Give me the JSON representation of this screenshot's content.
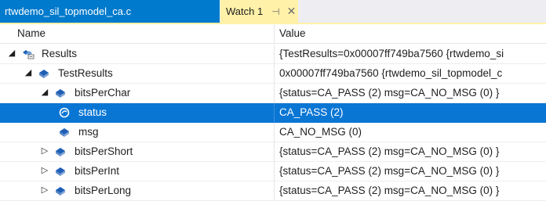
{
  "tabs": [
    {
      "label": "rtwdemo_sil_topmodel_ca.c",
      "active": false
    },
    {
      "label": "Watch 1",
      "active": true
    }
  ],
  "tab_icons": {
    "pin": "pin-icon",
    "close": "close-icon"
  },
  "columns": {
    "name": "Name",
    "value": "Value"
  },
  "colors": {
    "selection": "#0a76d4",
    "tab_active": "#fff1a8",
    "tab_inactive": "#007acc"
  },
  "rows": [
    {
      "name": "Results",
      "value": "{TestResults=0x00007ff749ba7560 {rtwdemo_si",
      "depth": 0,
      "expander": "expanded",
      "icon": "struct-icon"
    },
    {
      "name": "TestResults",
      "value": "0x00007ff749ba7560 {rtwdemo_sil_topmodel_c",
      "depth": 1,
      "expander": "expanded",
      "icon": "field-icon"
    },
    {
      "name": "bitsPerChar",
      "value": "{status=CA_PASS (2) msg=CA_NO_MSG (0) }",
      "depth": 2,
      "expander": "expanded",
      "icon": "field-icon"
    },
    {
      "name": "status",
      "value": "CA_PASS (2)",
      "depth": 3,
      "expander": "none",
      "icon": "status-field-icon",
      "selected": true
    },
    {
      "name": "msg",
      "value": "CA_NO_MSG (0)",
      "depth": 3,
      "expander": "none",
      "icon": "field-icon"
    },
    {
      "name": "bitsPerShort",
      "value": "{status=CA_PASS (2) msg=CA_NO_MSG (0) }",
      "depth": 2,
      "expander": "collapsed",
      "icon": "field-icon"
    },
    {
      "name": "bitsPerInt",
      "value": "{status=CA_PASS (2) msg=CA_NO_MSG (0) }",
      "depth": 2,
      "expander": "collapsed",
      "icon": "field-icon"
    },
    {
      "name": "bitsPerLong",
      "value": "{status=CA_PASS (2) msg=CA_NO_MSG (0) }",
      "depth": 2,
      "expander": "collapsed",
      "icon": "field-icon"
    }
  ]
}
